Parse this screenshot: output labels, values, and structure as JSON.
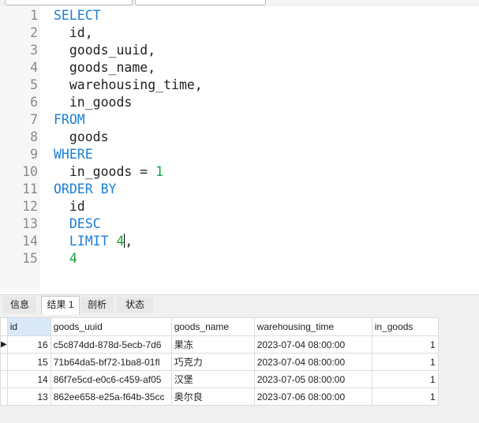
{
  "editor": {
    "lines": [
      {
        "num": "1",
        "tokens": [
          {
            "t": "SELECT",
            "k": "kw"
          }
        ]
      },
      {
        "num": "2",
        "tokens": [
          {
            "t": "  id,",
            "k": "id"
          }
        ]
      },
      {
        "num": "3",
        "tokens": [
          {
            "t": "  goods_uuid,",
            "k": "id"
          }
        ]
      },
      {
        "num": "4",
        "tokens": [
          {
            "t": "  goods_name,",
            "k": "id"
          }
        ]
      },
      {
        "num": "5",
        "tokens": [
          {
            "t": "  warehousing_time,",
            "k": "id"
          }
        ]
      },
      {
        "num": "6",
        "tokens": [
          {
            "t": "  in_goods",
            "k": "id"
          }
        ]
      },
      {
        "num": "7",
        "tokens": [
          {
            "t": "FROM",
            "k": "kw"
          }
        ]
      },
      {
        "num": "8",
        "tokens": [
          {
            "t": "  goods",
            "k": "id"
          }
        ]
      },
      {
        "num": "9",
        "tokens": [
          {
            "t": "WHERE",
            "k": "kw"
          }
        ]
      },
      {
        "num": "10",
        "tokens": [
          {
            "t": "  in_goods = ",
            "k": "id"
          },
          {
            "t": "1",
            "k": "num"
          }
        ]
      },
      {
        "num": "11",
        "tokens": [
          {
            "t": "ORDER BY",
            "k": "kw"
          }
        ]
      },
      {
        "num": "12",
        "tokens": [
          {
            "t": "  id",
            "k": "id"
          }
        ]
      },
      {
        "num": "13",
        "tokens": [
          {
            "t": "  DESC",
            "k": "kw"
          }
        ]
      },
      {
        "num": "14",
        "tokens": [
          {
            "t": "  LIMIT ",
            "k": "kw"
          },
          {
            "t": "4",
            "k": "num"
          },
          {
            "t": "CARET",
            "k": "caret"
          },
          {
            "t": ",",
            "k": "op"
          }
        ]
      },
      {
        "num": "15",
        "tokens": [
          {
            "t": "  4",
            "k": "num"
          }
        ]
      }
    ]
  },
  "result_tabs": [
    {
      "label": "信息",
      "active": false
    },
    {
      "label": "结果 1",
      "active": true
    },
    {
      "label": "剖析",
      "active": false
    },
    {
      "label": "状态",
      "active": false
    }
  ],
  "grid": {
    "columns": [
      "id",
      "goods_uuid",
      "goods_name",
      "warehousing_time",
      "in_goods"
    ],
    "rows": [
      {
        "id": "16",
        "goods_uuid": "c5c874dd-878d-5ecb-7d6",
        "goods_name": "果冻",
        "warehousing_time": "2023-07-04 08:00:00",
        "in_goods": "1",
        "current": true
      },
      {
        "id": "15",
        "goods_uuid": "71b64da5-bf72-1ba8-01fl",
        "goods_name": "巧克力",
        "warehousing_time": "2023-07-04 08:00:00",
        "in_goods": "1",
        "current": false
      },
      {
        "id": "14",
        "goods_uuid": "86f7e5cd-e0c6-c459-af05",
        "goods_name": "汉堡",
        "warehousing_time": "2023-07-05 08:00:00",
        "in_goods": "1",
        "current": false
      },
      {
        "id": "13",
        "goods_uuid": "862ee658-e25a-f64b-35cc",
        "goods_name": "奥尔良",
        "warehousing_time": "2023-07-06 08:00:00",
        "in_goods": "1",
        "current": false
      }
    ],
    "row_pointer": "▶"
  },
  "colors": {
    "keyword": "#1b7ed6",
    "number": "#17a339",
    "identifier": "#222222",
    "line_number": "#8a8a8a",
    "sorted_header": "#d9e9f8"
  }
}
